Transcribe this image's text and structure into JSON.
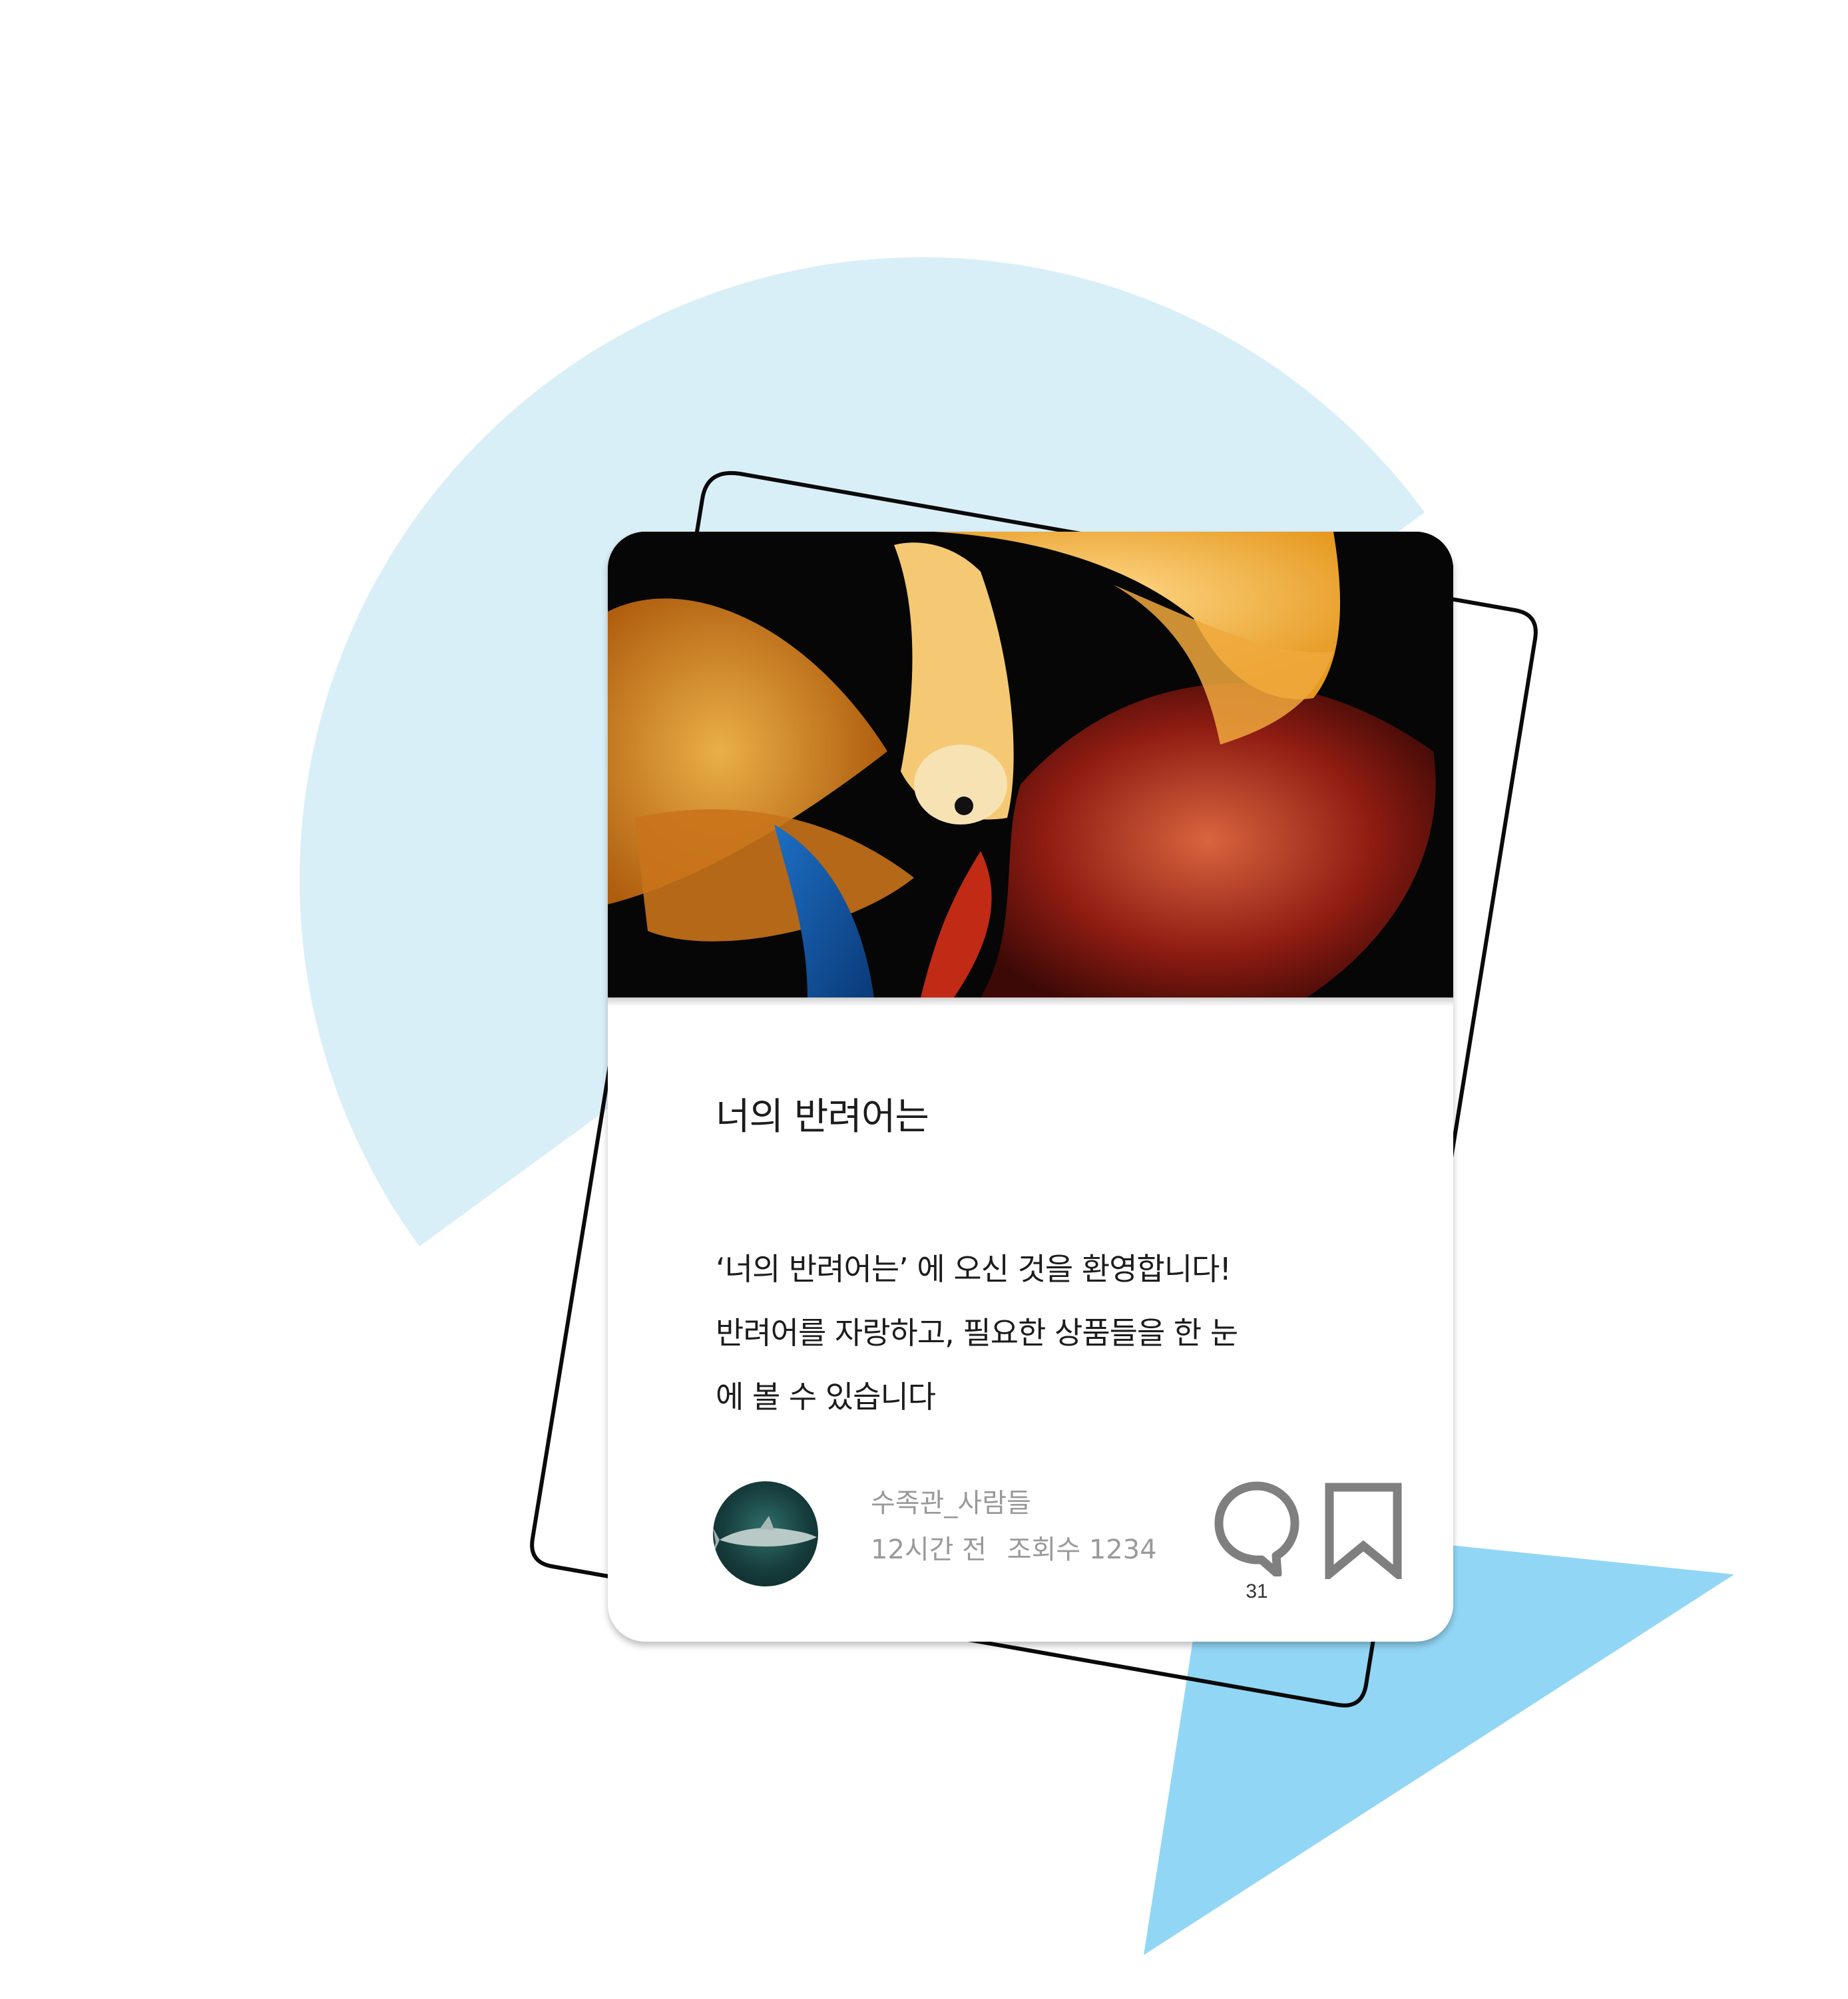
{
  "post": {
    "title": "너의 반려어는",
    "description_lines": [
      "‘너의 반려어는’ 에 오신 것을 환영합니다!",
      "반려어를 자랑하고, 필요한 상품들을 한 눈",
      "에 볼 수 있습니다"
    ],
    "image": {
      "subject": "betta fish photo"
    }
  },
  "author": {
    "name": "수족관_사람들",
    "time": "12시간 전",
    "views": "조회수 1234",
    "avatar": {
      "subject": "shark photo"
    }
  },
  "actions": {
    "comment": {
      "icon": "speech-bubble-icon",
      "count": "31"
    },
    "bookmark": {
      "icon": "bookmark-icon"
    }
  },
  "colors": {
    "circle": "#D9EFF8",
    "triangle": "#92D6F5",
    "frame_stroke": "#0a0a0a",
    "icon_gray": "#7f7f7f",
    "meta_text": "#9a9a9a"
  }
}
